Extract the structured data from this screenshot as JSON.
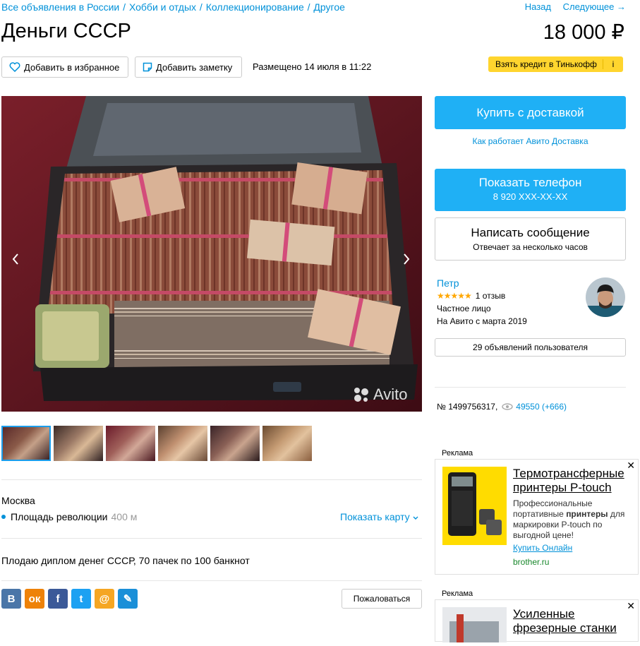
{
  "breadcrumb": {
    "items": [
      "Все объявления в России",
      "Хобби и отдых",
      "Коллекционирование",
      "Другое"
    ],
    "separator": "/"
  },
  "nav": {
    "back": "Назад",
    "next": "Следующее →"
  },
  "listing": {
    "title": "Деньги СССР",
    "price": "18 000 ₽",
    "posted": "Размещено 14 июля в 11:22",
    "location": {
      "city": "Москва",
      "metro": "Площадь революции",
      "distance": "400 м",
      "show_map": "Показать карту"
    },
    "description": "Плодаю диплом денег СССР, 70 пачек по 100 банкнот"
  },
  "actions": {
    "favorite": "Добавить в избранное",
    "note": "Добавить заметку",
    "credit": "Взять кредит в Тинькофф",
    "credit_info": "i",
    "report": "Пожаловаться"
  },
  "gallery": {
    "watermark": "Avito",
    "thumbnails_count": 6,
    "active_index": 0,
    "prev_icon": "chevron-left-icon",
    "next_icon": "chevron-right-icon"
  },
  "purchase": {
    "buy": "Купить с доставкой",
    "delivery_link": "Как работает Авито Доставка",
    "show_phone": "Показать телефон",
    "phone": "8 920 XXX-XX-XX",
    "write_message": "Написать сообщение",
    "reply_time": "Отвечает за несколько часов"
  },
  "seller": {
    "name": "Петр",
    "stars": "★★★★★",
    "reviews": "1 отзыв",
    "type": "Частное лицо",
    "since": "На Авито с марта 2019",
    "ads_count": "29 объявлений пользователя"
  },
  "stats": {
    "ad_number": "№ 1499756317,",
    "views": "49550 (+666)"
  },
  "ads": [
    {
      "label": "Реклама",
      "headline": "Термотрансферные принтеры P-touch",
      "body_prefix": "Профессиональные портативные ",
      "body_bold": "принтеры",
      "body_suffix": " для маркировки P-touch по выгодной цене!",
      "cta": "Купить Онлайн",
      "domain": "brother.ru",
      "close": "✕"
    },
    {
      "label": "Реклама",
      "headline": "Усиленные фрезерные станки",
      "close": "✕"
    }
  ],
  "social": {
    "vk": "В",
    "ok": "ок",
    "fb": "f",
    "tw": "t",
    "mail": "@",
    "lj": "✎"
  },
  "colors": {
    "accent": "#1fb0f5",
    "link": "#0091d9",
    "credit_bg": "#ffd52e",
    "stars": "#ffa700"
  }
}
